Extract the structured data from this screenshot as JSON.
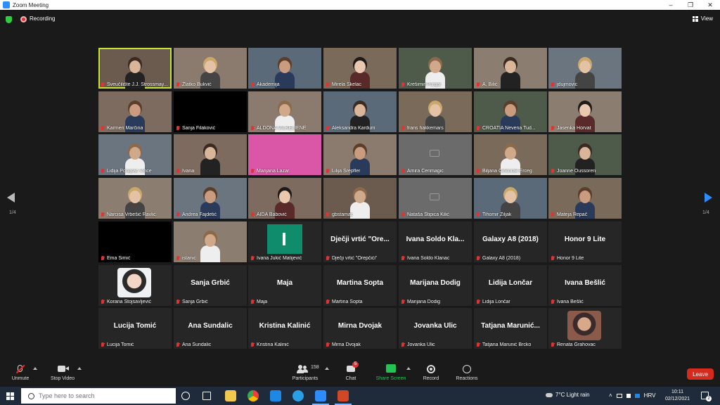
{
  "window": {
    "title": "Zoom Meeting",
    "min": "–",
    "max": "❐",
    "close": "✕"
  },
  "topbar": {
    "recording_label": "Recording",
    "view_label": "View"
  },
  "pagination": {
    "left": "1/4",
    "right": "1/4"
  },
  "colors": {
    "accent": "#2d8cff",
    "active_border": "#c5e336",
    "leave": "#d52b1e",
    "mic_muted": "#e23333"
  },
  "participants": [
    {
      "name": "Sveučilište J.J. Strossmay...",
      "video": true,
      "active": true
    },
    {
      "name": "Zlatko Bukvić",
      "video": true
    },
    {
      "name": "Akademija",
      "video": true
    },
    {
      "name": "Mirela Škelac",
      "video": true
    },
    {
      "name": "Krešimir Purgar",
      "video": true
    },
    {
      "name": "A. Bilić",
      "video": true
    },
    {
      "name": "jdujmovic",
      "video": true
    },
    {
      "name": "Karmen Marčina",
      "video": true
    },
    {
      "name": "Sanja Filaković",
      "video": false,
      "black": true
    },
    {
      "name": "ALDONA VILKELIENE",
      "video": true
    },
    {
      "name": "Aleksandra Kardum",
      "video": true
    },
    {
      "name": "frans hakkemars",
      "video": true
    },
    {
      "name": "CROATIA Nevena Tud...",
      "video": true
    },
    {
      "name": "Jasenka Horvat",
      "video": true
    },
    {
      "name": "Lidija Pongrac Vince",
      "video": true
    },
    {
      "name": "Ivana",
      "video": true
    },
    {
      "name": "Marijana Lazar",
      "video": true,
      "pink": true
    },
    {
      "name": "Lilija Šrepfler",
      "video": true
    },
    {
      "name": "Amira Cerimagic",
      "video": false,
      "camoff": true
    },
    {
      "name": "Biljana Činčurak Erceg",
      "video": true
    },
    {
      "name": "Joanne Oussoren",
      "video": true
    },
    {
      "name": "Narcisa Vrbešić Ravlić",
      "video": true
    },
    {
      "name": "Andrea Fajdetić",
      "video": true
    },
    {
      "name": "AIDA Babović",
      "video": true
    },
    {
      "name": "gbstamac",
      "video": true
    },
    {
      "name": "Nataša Stipica Kilić",
      "video": false,
      "camoff": true
    },
    {
      "name": "Tihomir Žiljak",
      "video": true
    },
    {
      "name": "Mateja Repač",
      "video": true
    },
    {
      "name": "Ema Šimić",
      "video": false,
      "black": true
    },
    {
      "name": "istanic",
      "video": true
    },
    {
      "name": "Ivana Jukić Matijević",
      "video": false,
      "green": true
    },
    {
      "name": "Dječji vrtić \"Orepčići\"",
      "video": false,
      "big": "Dječji vrtić \"Ore..."
    },
    {
      "name": "Ivana Soldo Klanac",
      "video": false,
      "big": "Ivana Soldo Kla..."
    },
    {
      "name": "Galaxy A8 (2018)",
      "video": false,
      "big": "Galaxy A8 (2018)"
    },
    {
      "name": "Honor 9 Lite",
      "video": false,
      "big": "Honor 9 Lite"
    },
    {
      "name": "Korana Stojsavljević",
      "video": false,
      "avatar": true
    },
    {
      "name": "Sanja Grbić",
      "video": false,
      "big": "Sanja Grbić"
    },
    {
      "name": "Maja",
      "video": false,
      "big": "Maja"
    },
    {
      "name": "Martina Sopta",
      "video": false,
      "big": "Martina Sopta"
    },
    {
      "name": "Marijana Dodig",
      "video": false,
      "big": "Marijana Dodig"
    },
    {
      "name": "Lidija Lončar",
      "video": false,
      "big": "Lidija Lončar"
    },
    {
      "name": "Ivana Bešlić",
      "video": false,
      "big": "Ivana Bešlić"
    },
    {
      "name": "Lucija Tomić",
      "video": false,
      "big": "Lucija Tomić"
    },
    {
      "name": "Ana Sundalic",
      "video": false,
      "big": "Ana Sundalic"
    },
    {
      "name": "Kristina Kalinić",
      "video": false,
      "big": "Kristina Kalinić"
    },
    {
      "name": "Mirna Dvojak",
      "video": false,
      "big": "Mirna Dvojak"
    },
    {
      "name": "Jovanka Ulic",
      "video": false,
      "big": "Jovanka Ulic"
    },
    {
      "name": "Tatjana Marunić Brcko",
      "video": false,
      "big": "Tatjana Marunić..."
    },
    {
      "name": "Renata Grahovac",
      "video": false,
      "avatar": true
    }
  ],
  "toolbar": {
    "unmute": "Unmute",
    "stop_video": "Stop Video",
    "participants": "Participants",
    "participants_count": "158",
    "chat": "Chat",
    "chat_badge": "5",
    "share_screen": "Share Screen",
    "record": "Record",
    "reactions": "Reactions",
    "leave": "Leave"
  },
  "taskbar": {
    "search_placeholder": "Type here to search",
    "weather": "7°C  Light rain",
    "lang": "HRV",
    "time": "10:11",
    "date": "02/12/2021",
    "notif_count": "2"
  }
}
